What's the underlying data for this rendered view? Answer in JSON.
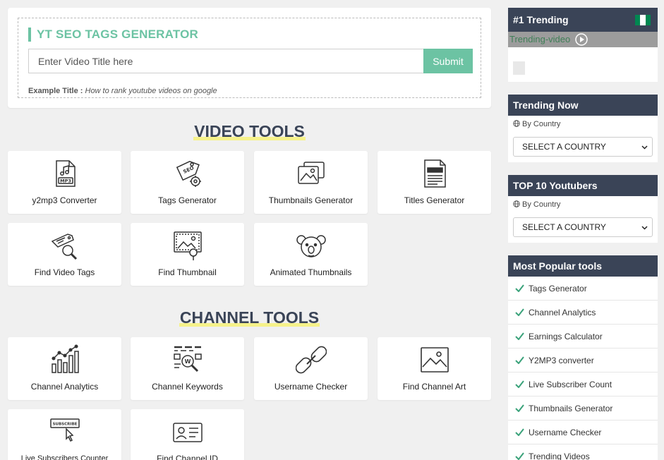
{
  "seo": {
    "title": "YT SEO TAGS GENERATOR",
    "input_placeholder": "Enter Video Title here",
    "submit_label": "Submit",
    "example_label": "Example Title :",
    "example_value": "How to rank youtube videos on google"
  },
  "video_tools": {
    "heading": "VIDEO TOOLS",
    "items": [
      {
        "label": "y2mp3 Converter",
        "icon": "mp3-file-icon"
      },
      {
        "label": "Tags Generator",
        "icon": "seo-tag-gear-icon"
      },
      {
        "label": "Thumbnails Generator",
        "icon": "images-icon"
      },
      {
        "label": "Titles Generator",
        "icon": "document-icon"
      },
      {
        "label": "Find Video Tags",
        "icon": "tag-search-icon"
      },
      {
        "label": "Find Thumbnail",
        "icon": "image-search-icon"
      },
      {
        "label": "Animated Thumbnails",
        "icon": "koala-icon"
      }
    ]
  },
  "channel_tools": {
    "heading": "CHANNEL TOOLS",
    "items": [
      {
        "label": "Channel Analytics",
        "icon": "analytics-chart-icon"
      },
      {
        "label": "Channel Keywords",
        "icon": "keyword-search-icon"
      },
      {
        "label": "Username Checker",
        "icon": "link-chain-icon"
      },
      {
        "label": "Find Channel Art",
        "icon": "picture-icon"
      },
      {
        "label": "Live Subscribers Counter",
        "icon": "subscribe-click-icon"
      },
      {
        "label": "Find Channel ID",
        "icon": "id-card-icon"
      }
    ]
  },
  "sidebar": {
    "trending": {
      "title": "#1 Trending",
      "image_alt": "Trending-video",
      "flag_colors": [
        "#008751",
        "#ffffff",
        "#008751"
      ]
    },
    "trending_now": {
      "title": "Trending Now",
      "by_country": "By Country",
      "select_value": "SELECT A COUNTRY"
    },
    "top_youtubers": {
      "title": "TOP 10 Youtubers",
      "by_country": "By Country",
      "select_value": "SELECT A COUNTRY"
    },
    "popular": {
      "title": "Most Popular tools",
      "items": [
        "Tags Generator",
        "Channel Analytics",
        "Earnings Calculator",
        "Y2MP3 converter",
        "Live Subscriber Count",
        "Thumbnails Generator",
        "Username Checker",
        "Trending Videos"
      ]
    }
  },
  "colors": {
    "accent": "#6cc3a3",
    "sidebar_header": "#3a4457",
    "heading_highlight": "#f6f28a",
    "check": "#3aa27a"
  }
}
